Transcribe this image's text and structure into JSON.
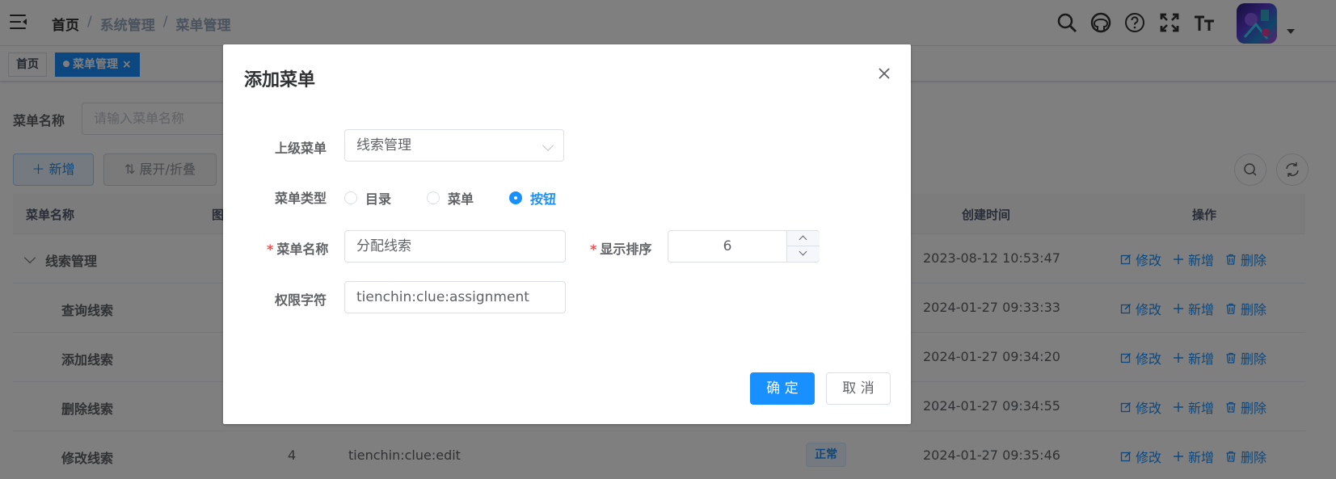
{
  "navbar": {
    "breadcrumb": [
      "首页",
      "系统管理",
      "菜单管理"
    ],
    "icons": [
      "search-icon",
      "github-icon",
      "help-icon",
      "fullscreen-icon",
      "font-size-icon"
    ],
    "avatar": "avatar"
  },
  "tags": [
    {
      "label": "首页",
      "active": false
    },
    {
      "label": "菜单管理",
      "active": true,
      "close": "×"
    }
  ],
  "search": {
    "label": "菜单名称",
    "placeholder": "请输入菜单名称"
  },
  "toolbar": {
    "add_label": "新增",
    "toggle_label": "展开/折叠"
  },
  "table": {
    "headers": [
      "菜单名称",
      "图",
      "创建时间",
      "操作"
    ],
    "rows": [
      {
        "name": "线索管理",
        "sort": "",
        "perm": "",
        "status": "",
        "created": "2023-08-12 10:53:47"
      },
      {
        "name": "查询线索",
        "sort": "",
        "perm": "",
        "status": "",
        "created": "2024-01-27 09:33:33"
      },
      {
        "name": "添加线索",
        "sort": "",
        "perm": "",
        "status": "",
        "created": "2024-01-27 09:34:20"
      },
      {
        "name": "删除线索",
        "sort": "",
        "perm": "",
        "status": "",
        "created": "2024-01-27 09:34:55"
      },
      {
        "name": "修改线索",
        "sort": "4",
        "perm": "tienchin:clue:edit",
        "status": "正常",
        "created": "2024-01-27 09:35:46"
      }
    ],
    "ops": {
      "edit": "修改",
      "add": "新增",
      "delete": "删除"
    }
  },
  "dialog": {
    "title": "添加菜单",
    "parent_label": "上级菜单",
    "parent_value": "线索管理",
    "type_label": "菜单类型",
    "type_options": [
      "目录",
      "菜单",
      "按钮"
    ],
    "type_selected": "按钮",
    "name_label": "菜单名称",
    "name_value": "分配线索",
    "order_label": "显示排序",
    "order_value": "6",
    "perm_label": "权限字符",
    "perm_value": "tienchin:clue:assignment",
    "required_mark": "*",
    "ok_label": "确 定",
    "cancel_label": "取 消"
  },
  "colors": {
    "primary": "#1890ff",
    "overlay": "rgba(0,0,0,0.5)"
  }
}
